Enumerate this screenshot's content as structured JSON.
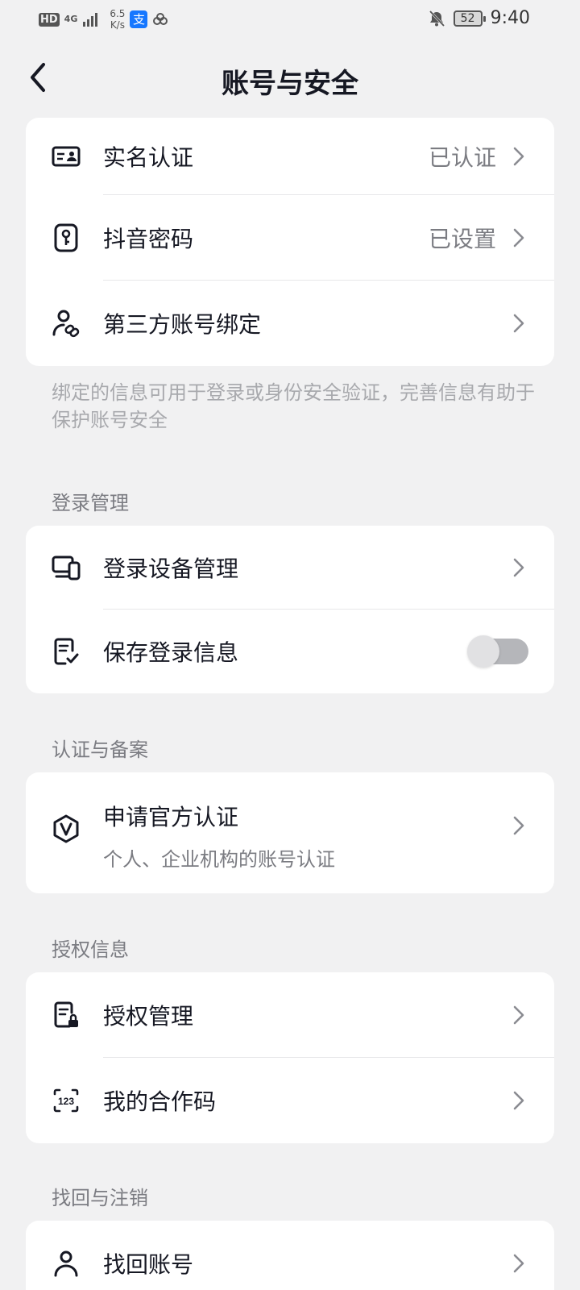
{
  "status_bar": {
    "hd": "HD",
    "network": "4G",
    "speed_value": "6.5",
    "speed_unit": "K/s",
    "alipay_glyph": "支",
    "battery": "52",
    "time": "9:40"
  },
  "header": {
    "title": "账号与安全"
  },
  "account_card": {
    "items": [
      {
        "label": "实名认证",
        "value": "已认证",
        "icon": "id-card-icon"
      },
      {
        "label": "抖音密码",
        "value": "已设置",
        "icon": "password-key-icon"
      },
      {
        "label": "第三方账号绑定",
        "value": "",
        "icon": "user-link-icon"
      }
    ]
  },
  "binding_note": "绑定的信息可用于登录或身份安全验证，完善信息有助于保护账号安全",
  "login_section": {
    "title": "登录管理",
    "items": [
      {
        "label": "登录设备管理",
        "icon": "devices-icon"
      },
      {
        "label": "保存登录信息",
        "icon": "saved-info-icon",
        "toggle_on": false
      }
    ]
  },
  "certification_section": {
    "title": "认证与备案",
    "items": [
      {
        "label": "申请官方认证",
        "sublabel": "个人、企业机构的账号认证",
        "icon": "verified-v-icon"
      }
    ]
  },
  "authorization_section": {
    "title": "授权信息",
    "items": [
      {
        "label": "授权管理",
        "icon": "authorization-doc-icon"
      },
      {
        "label": "我的合作码",
        "icon": "code-123-icon"
      }
    ]
  },
  "recovery_section": {
    "title": "找回与注销",
    "items": [
      {
        "label": "找回账号",
        "icon": "person-icon"
      }
    ]
  },
  "colors": {
    "background": "#f1f1f2",
    "card": "#ffffff",
    "text_primary": "#161823",
    "text_secondary": "#7b7c82",
    "text_hint": "#a8a9ad",
    "toggle_off_track": "#b5b6ba"
  }
}
